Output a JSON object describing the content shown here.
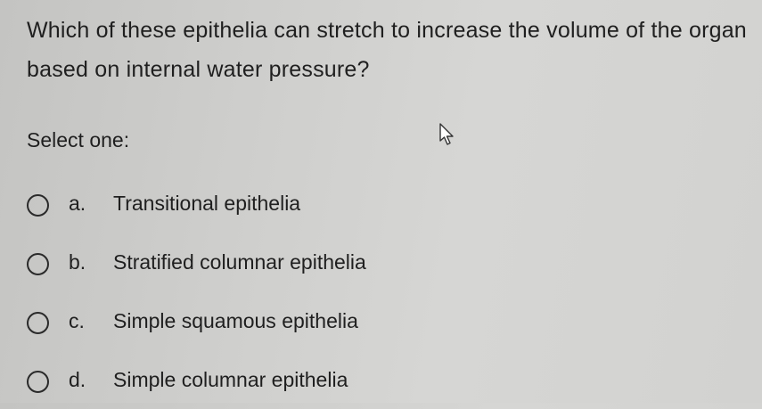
{
  "question": {
    "text": "Which of these epithelia can stretch to increase the volume of the organ based on internal water pressure?"
  },
  "prompt": "Select one:",
  "options": [
    {
      "letter": "a.",
      "text": "Transitional epithelia"
    },
    {
      "letter": "b.",
      "text": "Stratified columnar epithelia"
    },
    {
      "letter": "c.",
      "text": "Simple squamous epithelia"
    },
    {
      "letter": "d.",
      "text": "Simple columnar epithelia"
    }
  ],
  "icons": {
    "radio": "radio-unchecked-icon",
    "cursor": "mouse-pointer-icon"
  }
}
